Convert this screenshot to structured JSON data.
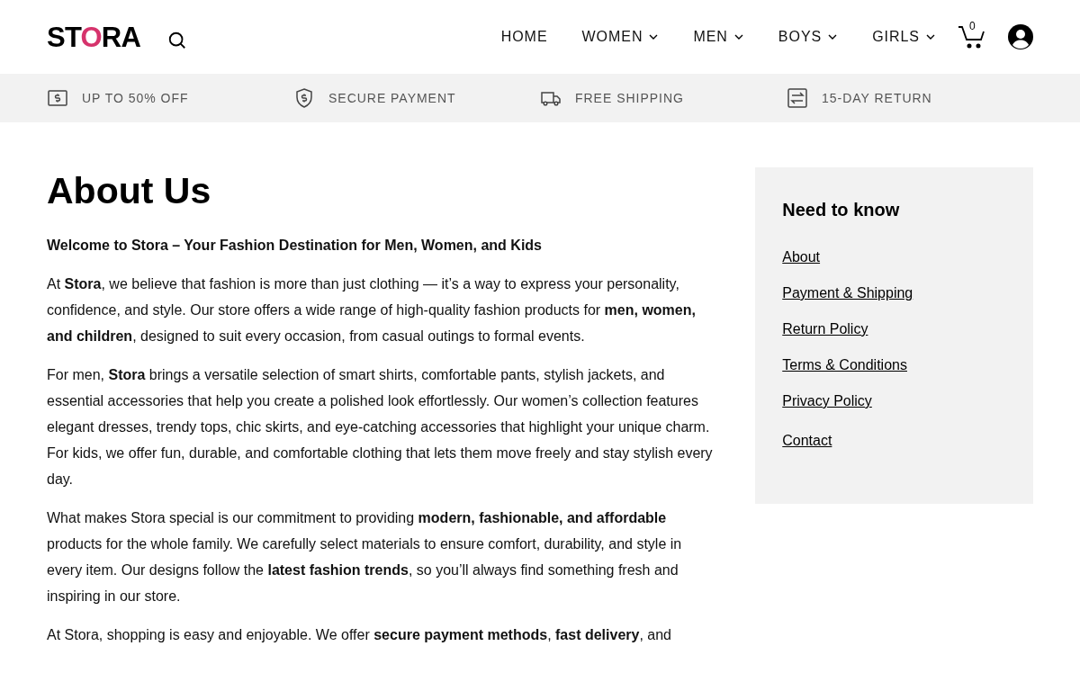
{
  "header": {
    "logo": {
      "prefix": "ST",
      "accent": "O",
      "suffix": "RA"
    },
    "nav": [
      {
        "label": "HOME",
        "dropdown": false
      },
      {
        "label": "WOMEN",
        "dropdown": true
      },
      {
        "label": "MEN",
        "dropdown": true
      },
      {
        "label": "BOYS",
        "dropdown": true
      },
      {
        "label": "GIRLS",
        "dropdown": true
      }
    ],
    "cart_count": "0"
  },
  "features": [
    {
      "kind": "discount",
      "label": "UP TO 50% OFF"
    },
    {
      "kind": "secure",
      "label": "SECURE PAYMENT"
    },
    {
      "kind": "shipping",
      "label": "FREE SHIPPING"
    },
    {
      "kind": "return",
      "label": "15-DAY RETURN"
    }
  ],
  "page": {
    "title": "About Us",
    "paragraphs": [
      "**Welcome to Stora – Your Fashion Destination for Men, Women, and Kids**",
      "At **Stora**, we believe that fashion is more than just clothing — it’s a way to express your personality, confidence, and style. Our store offers a wide range of high-quality fashion products for **men, women, and children**, designed to suit every occasion, from casual outings to formal events.",
      "For men, **Stora** brings a versatile selection of smart shirts, comfortable pants, stylish jackets, and essential accessories that help you create a polished look effortlessly. Our women’s collection features elegant dresses, trendy tops, chic skirts, and eye-catching accessories that highlight your unique charm. For kids, we offer fun, durable, and comfortable clothing that lets them move freely and stay stylish every day.",
      "What makes Stora special is our commitment to providing **modern, fashionable, and affordable** products for the whole family. We carefully select materials to ensure comfort, durability, and style in every item. Our designs follow the **latest fashion trends**, so you’ll always find something fresh and inspiring in our store.",
      "At Stora, shopping is easy and enjoyable. We offer **secure payment methods**, **fast delivery**, and"
    ]
  },
  "sidebar": {
    "title": "Need to know",
    "links": [
      "About",
      "Payment & Shipping",
      "Return Policy",
      "Terms & Conditions",
      "Privacy Policy",
      "Contact"
    ]
  }
}
